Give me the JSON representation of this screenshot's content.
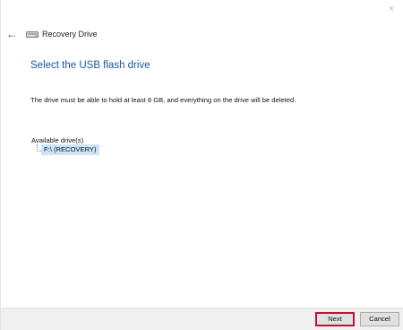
{
  "window": {
    "title": "Recovery Drive",
    "close_glyph": "×"
  },
  "header": {
    "back_glyph": "←",
    "drive_icon": "drive-icon"
  },
  "main": {
    "heading": "Select the USB flash drive",
    "description": "The drive must be able to hold at least 8 GB, and everything on the drive will be deleted.",
    "available_label": "Available drive(s)",
    "drives": [
      {
        "label": "F:\\ (RECOVERY)",
        "selected": true
      }
    ]
  },
  "footer": {
    "next_label": "Next",
    "cancel_label": "Cancel"
  },
  "colors": {
    "heading": "#1b54a8",
    "selection": "#cce4f7",
    "highlight_border": "#c8102e",
    "footer_bg": "#f0f0f0"
  }
}
